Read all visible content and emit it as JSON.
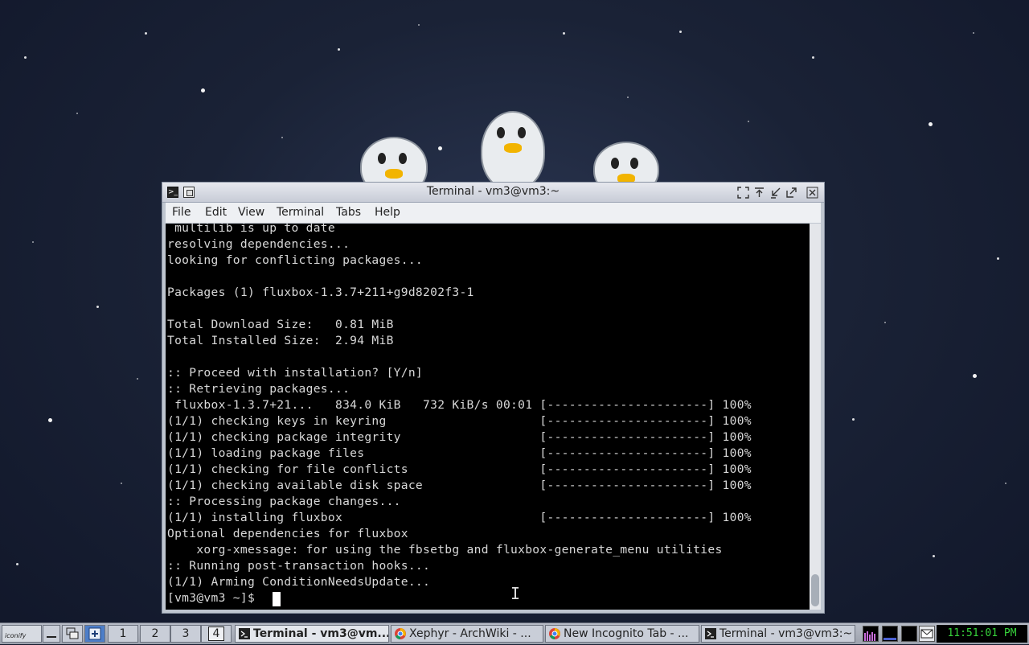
{
  "window": {
    "title": "Terminal - vm3@vm3:~",
    "menu": [
      "File",
      "Edit",
      "View",
      "Terminal",
      "Tabs",
      "Help"
    ]
  },
  "terminal": {
    "lines": [
      " multilib is up to date",
      "resolving dependencies...",
      "looking for conflicting packages...",
      "",
      "Packages (1) fluxbox-1.3.7+211+g9d8202f3-1",
      "",
      "Total Download Size:   0.81 MiB",
      "Total Installed Size:  2.94 MiB",
      "",
      ":: Proceed with installation? [Y/n]",
      ":: Retrieving packages...",
      " fluxbox-1.3.7+21...   834.0 KiB   732 KiB/s 00:01 [----------------------] 100%",
      "(1/1) checking keys in keyring                     [----------------------] 100%",
      "(1/1) checking package integrity                   [----------------------] 100%",
      "(1/1) loading package files                        [----------------------] 100%",
      "(1/1) checking for file conflicts                  [----------------------] 100%",
      "(1/1) checking available disk space                [----------------------] 100%",
      ":: Processing package changes...",
      "(1/1) installing fluxbox                           [----------------------] 100%",
      "Optional dependencies for fluxbox",
      "    xorg-xmessage: for using the fbsetbg and fluxbox-generate_menu utilities",
      ":: Running post-transaction hooks...",
      "(1/1) Arming ConditionNeedsUpdate...",
      "[vm3@vm3 ~]$ "
    ]
  },
  "taskbar": {
    "launcher_label": "iconify",
    "workspaces": [
      "1",
      "2",
      "3",
      "4"
    ],
    "active_workspace": "4",
    "tasks": [
      {
        "label": "Terminal - vm3@vm...",
        "icon": "terminal-icon",
        "active": true
      },
      {
        "label": "Xephyr - ArchWiki - ...",
        "icon": "chrome-icon",
        "active": false
      },
      {
        "label": "New Incognito Tab - ...",
        "icon": "chrome-icon",
        "active": false
      },
      {
        "label": "Terminal - vm3@vm3:~",
        "icon": "terminal-icon",
        "active": false
      }
    ],
    "clock": "11:51:01 PM"
  },
  "colors": {
    "terminal_bg": "#000000",
    "terminal_fg": "#d8d8d8",
    "clock_fg": "#37d43b"
  }
}
